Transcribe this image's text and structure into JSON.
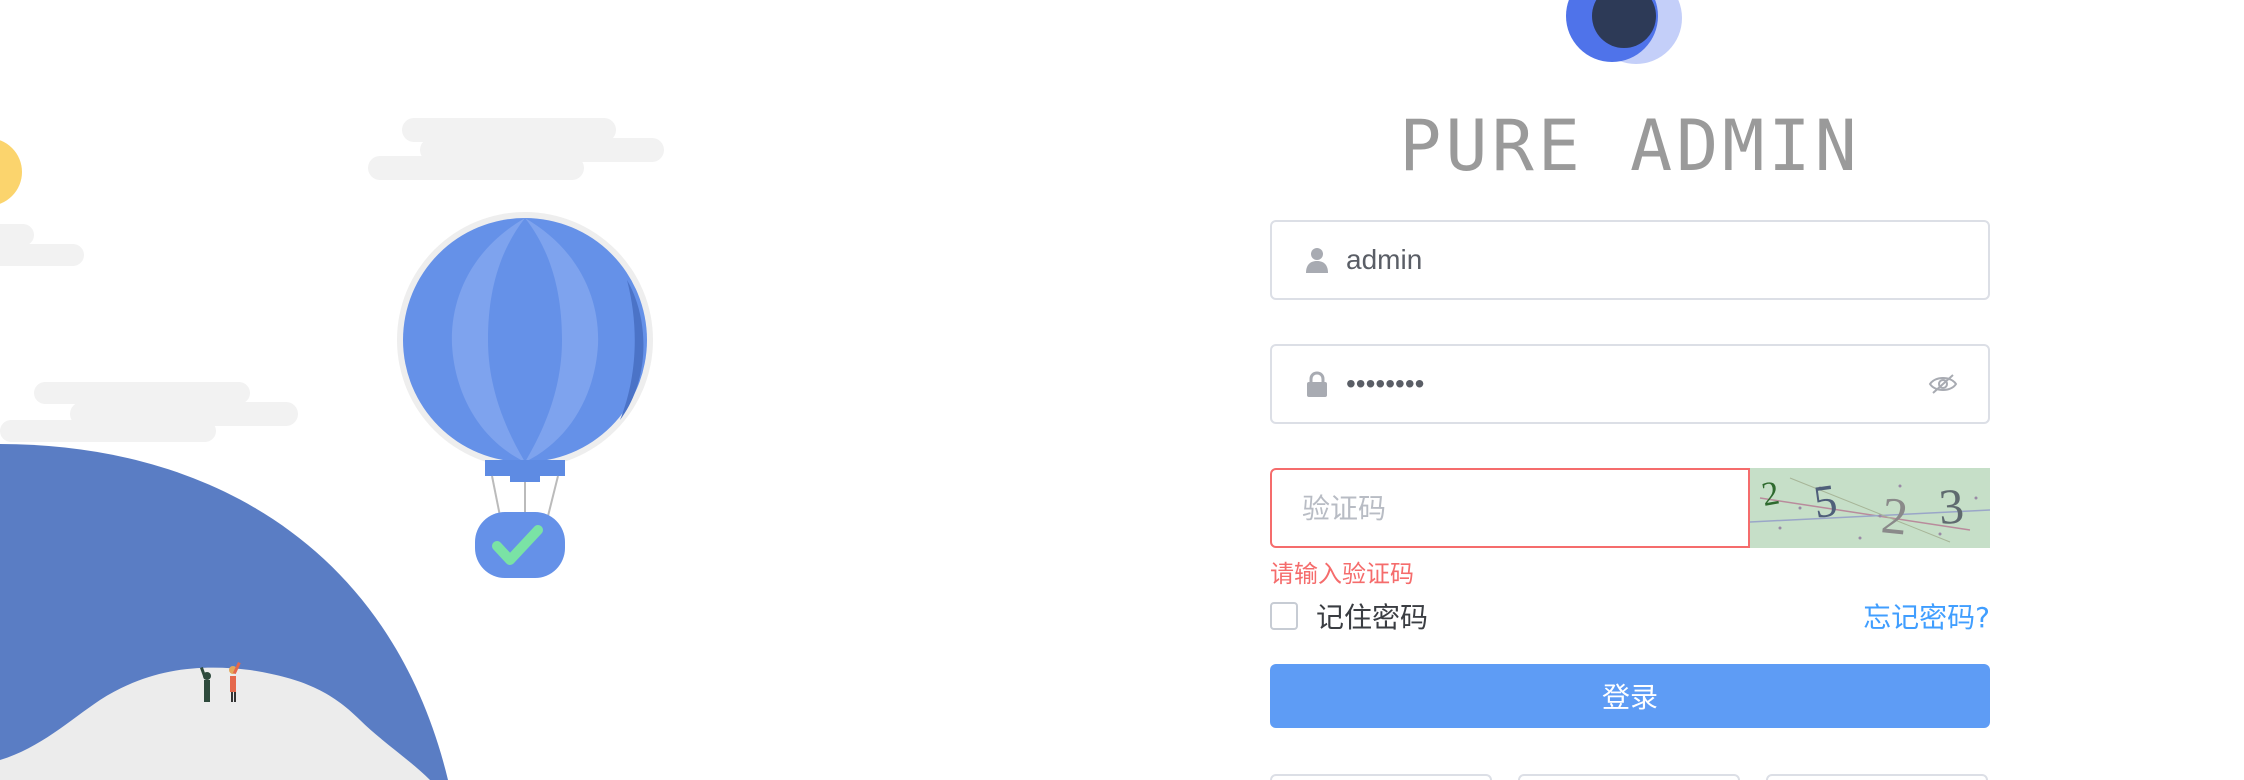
{
  "brand": {
    "title": "PURE ADMIN"
  },
  "login": {
    "username_value": "admin",
    "password_value": "••••••••",
    "captcha_placeholder": "验证码",
    "captcha_code": "2523",
    "captcha_error": "请输入验证码",
    "remember_label": "记住密码",
    "forgot_label": "忘记密码?",
    "submit_label": "登录"
  },
  "icons": {
    "user": "user-icon",
    "lock": "lock-icon",
    "eye": "eye-off-icon",
    "check": "check-icon"
  },
  "colors": {
    "primary": "#5e9cf5",
    "link": "#409eff",
    "error": "#f56c6c",
    "illustration_blue": "#5a7dc4",
    "balloon_blue": "#6591e8",
    "check_green": "#7ae3a5",
    "captcha_bg": "#c6dfc8"
  }
}
